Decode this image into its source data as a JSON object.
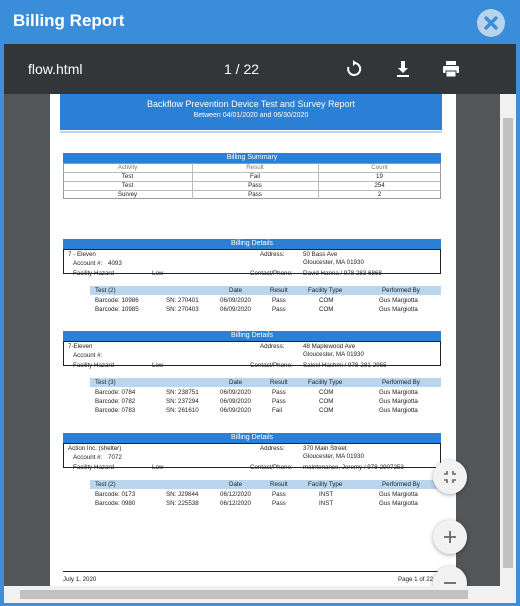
{
  "modal": {
    "title": "Billing Report"
  },
  "toolbar": {
    "filename": "flow.html",
    "page_indicator": "1 / 22"
  },
  "icons": {
    "close": "close-icon",
    "rotate": "rotate-icon",
    "download": "download-icon",
    "print": "print-icon",
    "fit": "fit-to-page-icon",
    "zoom_in": "zoom-in-icon",
    "zoom_out": "zoom-out-icon"
  },
  "colors": {
    "accent": "#3a8dd9",
    "band": "#2b7fd4",
    "light_band": "#b9d6ee",
    "toolbar": "#323639"
  },
  "report": {
    "title": "Backflow Prevention Device Test and Survey Report",
    "subtitle": "Between 04/01/2020 and 06/30/2020",
    "summary": {
      "heading": "Billing Summary",
      "columns": [
        "Activity",
        "Result",
        "Count"
      ],
      "rows": [
        [
          "Test",
          "Fail",
          "19"
        ],
        [
          "Test",
          "Pass",
          "254"
        ],
        [
          "Survey",
          "Pass",
          "2"
        ]
      ]
    },
    "details_heading": "Billing Details",
    "labels": {
      "account": "Account #:",
      "facility": "Facility Hazard",
      "address": "Address:",
      "contact": "Contact/Phone:"
    },
    "test_columns": {
      "date": "Date",
      "result": "Result",
      "type": "Facility Type",
      "by": "Performed By"
    },
    "accounts": [
      {
        "name": "7 - Eleven",
        "account": "4093",
        "hazard": "Low",
        "address1": "50 Bass Ave",
        "address2": "Gloucester, MA 01930",
        "contact": "David Hanna / 978 283 6868",
        "test_header": "Test (2)",
        "tests": [
          [
            "Barcode: 10986",
            "SN: 270401",
            "06/09/2020",
            "Pass",
            "COM",
            "Gus Margiotta"
          ],
          [
            "Barcode: 10985",
            "SN: 270403",
            "06/09/2020",
            "Pass",
            "COM",
            "Gus Margiotta"
          ]
        ]
      },
      {
        "name": "7-Eleven",
        "account": "",
        "hazard": "Low",
        "address1": "48 Maplewood Ave",
        "address2": "Gloucester, MA 01930",
        "contact": "Saleel Hashmi / 978-281-2955",
        "test_header": "Test (3)",
        "tests": [
          [
            "Barcode: 0784",
            "SN: 238751",
            "06/09/2020",
            "Pass",
            "COM",
            "Gus Margiotta"
          ],
          [
            "Barcode: 0782",
            "SN: 237294",
            "06/09/2020",
            "Pass",
            "COM",
            "Gus Margiotta"
          ],
          [
            "Barcode: 0783",
            "SN: 261610",
            "06/09/2020",
            "Fail",
            "COM",
            "Gus Margiotta"
          ]
        ]
      },
      {
        "name": "Action Inc. (shelter)",
        "account": "7072",
        "hazard": "Low",
        "address1": "370 Main Street",
        "address2": "Gloucester, MA 01930",
        "contact": "maintenance, Jeremy / 978-2907253",
        "test_header": "Test (2)",
        "tests": [
          [
            "Barcode: 0173",
            "SN: J29844",
            "06/12/2020",
            "Pass",
            "INST",
            "Gus Margiotta"
          ],
          [
            "Barcode: 0980",
            "SN: 225538",
            "06/12/2020",
            "Pass",
            "INST",
            "Gus Margiotta"
          ]
        ]
      }
    ],
    "footer": {
      "date": "July 1, 2020",
      "page": "Page 1 of 22"
    }
  }
}
